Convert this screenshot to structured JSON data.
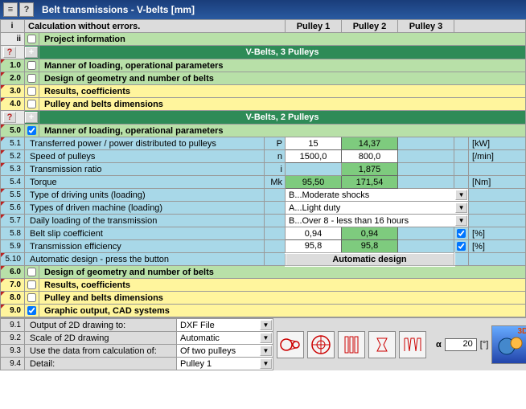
{
  "title": "Belt transmissions - V-belts [mm]",
  "status": "Calculation without errors.",
  "pulley_headers": [
    "Pulley 1",
    "Pulley 2",
    "Pulley 3"
  ],
  "proj_info": "Project information",
  "sect3p": "V-Belts, 3 Pulleys",
  "sect2p": "V-Belts, 2 Pulleys",
  "rows3p": {
    "r1_0": "Manner of loading, operational parameters",
    "r2_0": "Design of geometry and number of belts",
    "r3_0": "Results, coefficients",
    "r4_0": "Pulley and belts dimensions"
  },
  "r5_0": "Manner of loading, operational parameters",
  "params": [
    {
      "n": "5.1",
      "label": "Transferred power / power distributed to pulleys",
      "sym": "P",
      "v1": "15",
      "v2": "14,37",
      "unit": "[kW]"
    },
    {
      "n": "5.2",
      "label": "Speed of pulleys",
      "sym": "n",
      "v1": "1500,0",
      "v2": "800,0",
      "unit": "[/min]"
    },
    {
      "n": "5.3",
      "label": "Transmission ratio",
      "sym": "i",
      "v1": "",
      "v2": "1,875",
      "unit": ""
    },
    {
      "n": "5.4",
      "label": "Torque",
      "sym": "Mk",
      "v1": "95,50",
      "v2": "171,54",
      "unit": "[Nm]"
    }
  ],
  "selects": [
    {
      "n": "5.5",
      "label": "Type of driving units (loading)",
      "val": "B...Moderate shocks"
    },
    {
      "n": "5.6",
      "label": "Types of driven machine (loading)",
      "val": "A...Light duty"
    },
    {
      "n": "5.7",
      "label": "Daily loading of the transmission",
      "val": "B...Over 8 - less than 16 hours"
    }
  ],
  "coef": [
    {
      "n": "5.8",
      "label": "Belt slip coefficient",
      "v1": "0,94",
      "v2": "0,94",
      "unit": "[%]"
    },
    {
      "n": "5.9",
      "label": "Transmission efficiency",
      "v1": "95,8",
      "v2": "95,8",
      "unit": "[%]"
    }
  ],
  "auto": {
    "n": "5.10",
    "label": "Automatic design - press the button",
    "btn": "Automatic design"
  },
  "rows2p_tail": {
    "r6_0": "Design of geometry and number of belts",
    "r7_0": "Results, coefficients",
    "r8_0": "Pulley and belts dimensions"
  },
  "r9_0": "Graphic output, CAD systems",
  "idx": {
    "i": "i",
    "ii": "ii",
    "q": "?",
    "plus": "+",
    "r1": "1.0",
    "r2": "2.0",
    "r3": "3.0",
    "r4": "4.0",
    "r5": "5.0",
    "r6": "6.0",
    "r7": "7.0",
    "r8": "8.0",
    "r9": "9.0"
  },
  "cad": {
    "r91": {
      "n": "9.1",
      "label": "Output of 2D drawing to:",
      "val": "DXF File"
    },
    "r92": {
      "n": "9.2",
      "label": "Scale of 2D drawing",
      "val": "Automatic"
    },
    "r93": {
      "n": "9.3",
      "label": "Use the data from calculation of:",
      "val": "Of two pulleys"
    },
    "r94": {
      "n": "9.4",
      "label": "Detail:",
      "val": "Pulley 1"
    },
    "alpha_sym": "α",
    "alpha_val": "20",
    "alpha_unit": "[°]"
  },
  "threeD": "3D"
}
